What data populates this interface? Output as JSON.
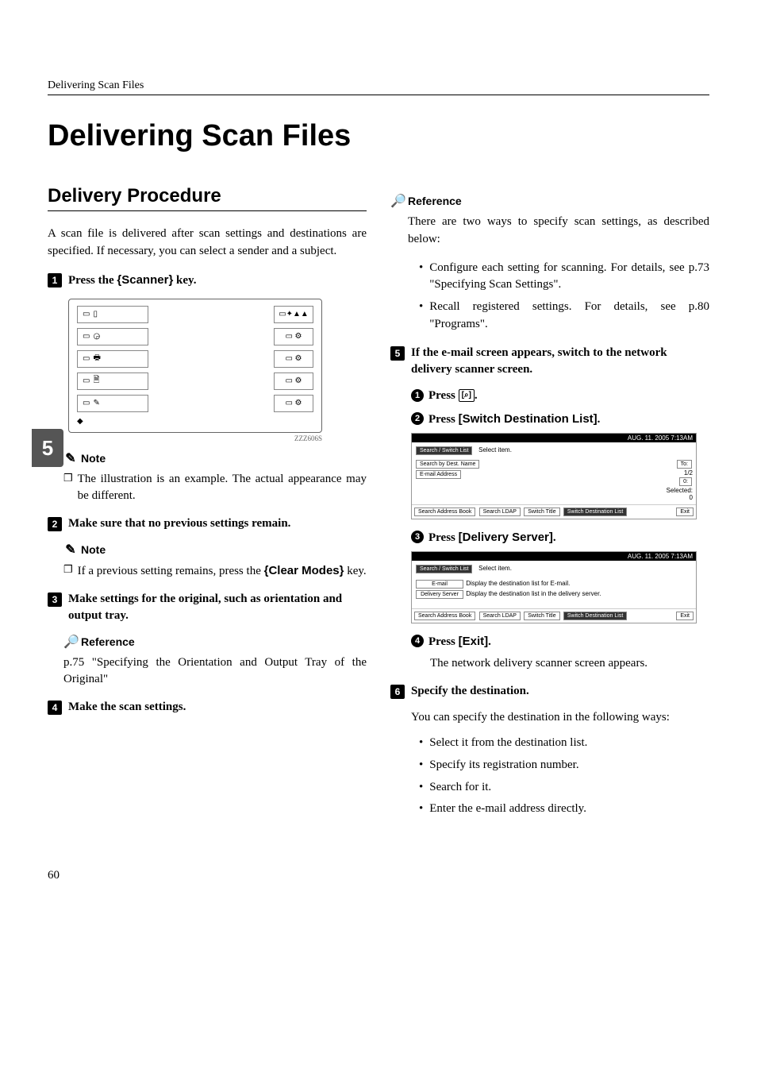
{
  "header_section": "Delivering Scan Files",
  "title": "Delivering Scan Files",
  "h2": "Delivery Procedure",
  "intro": "A scan file is delivered after scan settings and destinations are specified. If necessary, you can select a sender and a subject.",
  "tab_badge": "5",
  "page_num": "60",
  "step1": {
    "num": "1",
    "text_pre": "Press the ",
    "key_open": "{",
    "key": "Scanner",
    "key_close": "}",
    "text_post": " key."
  },
  "panel_caption": "ZZZ606S",
  "note_label": "Note",
  "step1_note": "The illustration is an example. The actual appearance may be different.",
  "step2": {
    "num": "2",
    "text": "Make sure that no previous settings remain."
  },
  "step2_note_pre": "If a previous setting remains, press the ",
  "step2_note_key": "Clear Modes",
  "step2_note_post": " key.",
  "step3": {
    "num": "3",
    "text": "Make settings for the original, such as orientation and output tray."
  },
  "ref_label": "Reference",
  "step3_ref": "p.75 \"Specifying the Orientation and Output Tray of the Original\"",
  "step4": {
    "num": "4",
    "text": "Make the scan settings."
  },
  "ref2_intro": "There are two ways to specify scan settings, as described below:",
  "ref2_b1": "Configure each setting for scanning. For details, see p.73 \"Specifying Scan Settings\".",
  "ref2_b2": "Recall registered settings. For details, see p.80 \"Programs\".",
  "step5": {
    "num": "5",
    "text": "If the e-mail screen appears, switch to the network delivery scanner screen."
  },
  "sub1": {
    "n": "1",
    "pre": "Press ",
    "icon": "[⌕]",
    "post": "."
  },
  "sub2": {
    "n": "2",
    "pre": "Press ",
    "label": "[Switch Destination List]",
    "post": "."
  },
  "sub3": {
    "n": "3",
    "pre": "Press ",
    "label": "[Delivery Server]",
    "post": "."
  },
  "sub4": {
    "n": "4",
    "pre": "Press ",
    "label": "[Exit]",
    "post": "."
  },
  "sub4_result": "The network delivery scanner screen appears.",
  "step6": {
    "num": "6",
    "text": "Specify the destination."
  },
  "step6_intro": "You can specify the destination in the following ways:",
  "step6_b1": "Select it from the destination list.",
  "step6_b2": "Specify its registration number.",
  "step6_b3": "Search for it.",
  "step6_b4": "Enter the e-mail address directly.",
  "screen1": {
    "top": "AUG.  11. 2005   7:13AM",
    "search_switch": "Search / Switch List",
    "select_item": "Select item.",
    "search_dest": "Search by Dest. Name",
    "email_addr": "E-mail Address",
    "sab": "Search Address Book",
    "ldap": "Search LDAP",
    "stitle": "Switch Title",
    "sdl": "Switch Destination List",
    "to": "To:",
    "one_two": "1/2",
    "zero": "0:",
    "selected": "Selected:",
    "zero2": "0",
    "exit": "Exit"
  },
  "screen2": {
    "top": "AUG.  11. 2005   7:13AM",
    "search_switch": "Search / Switch List",
    "select_item": "Select item.",
    "email": "E-mail",
    "email_desc": "Display the destination list for E-mail.",
    "delivery": "Delivery Server",
    "delivery_desc": "Display the destination list in the delivery server.",
    "sab": "Search Address Book",
    "ldap": "Search LDAP",
    "stitle": "Switch Title",
    "sdl": "Switch Destination List",
    "exit": "Exit"
  }
}
